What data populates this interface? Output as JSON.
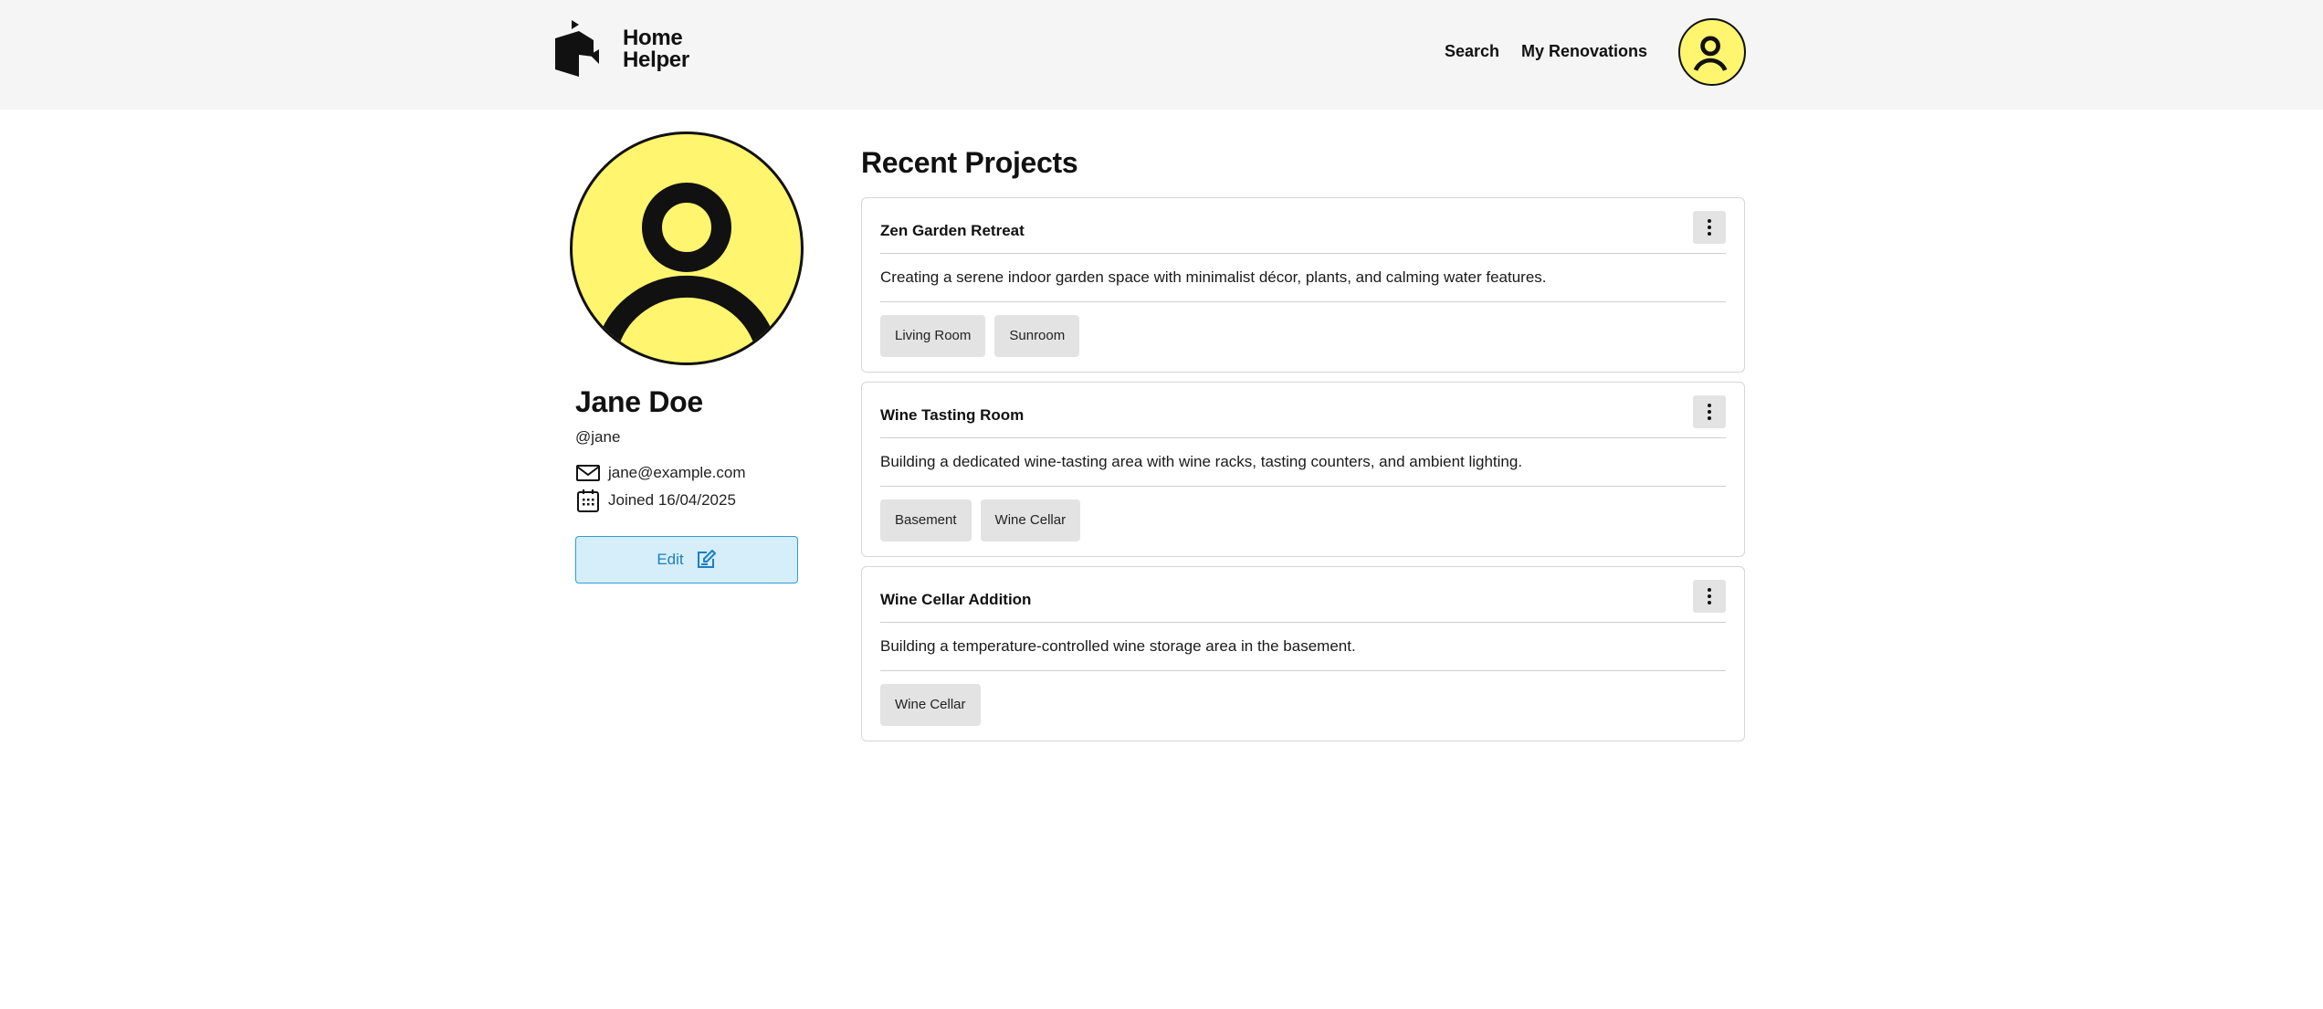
{
  "header": {
    "logo_line1": "Home",
    "logo_line2": "Helper",
    "nav": {
      "search": "Search",
      "renovations": "My Renovations"
    }
  },
  "profile": {
    "name": "Jane Doe",
    "handle": "@jane",
    "email": "jane@example.com",
    "joined": "Joined 16/04/2025",
    "edit_label": "Edit"
  },
  "projects": {
    "title": "Recent Projects",
    "items": [
      {
        "title": "Zen Garden Retreat",
        "description": "Creating a serene indoor garden space with minimalist décor, plants, and calming water features.",
        "tags": [
          "Living Room",
          "Sunroom"
        ]
      },
      {
        "title": "Wine Tasting Room",
        "description": "Building a dedicated wine-tasting area with wine racks, tasting counters, and ambient lighting.",
        "tags": [
          "Basement",
          "Wine Cellar"
        ]
      },
      {
        "title": "Wine Cellar Addition",
        "description": "Building a temperature-controlled wine storage area in the basement.",
        "tags": [
          "Wine Cellar"
        ]
      }
    ]
  },
  "colors": {
    "avatar_bg": "#fff56e",
    "header_bg": "#f5f5f5",
    "edit_bg": "#d5eef9",
    "edit_accent": "#1b7fc0"
  },
  "icons": {
    "logo": "home-helper-logo-icon",
    "avatar": "user-silhouette-icon",
    "email": "envelope-icon",
    "joined": "calendar-icon",
    "edit": "edit-pencil-icon",
    "menu": "more-vertical-icon"
  }
}
